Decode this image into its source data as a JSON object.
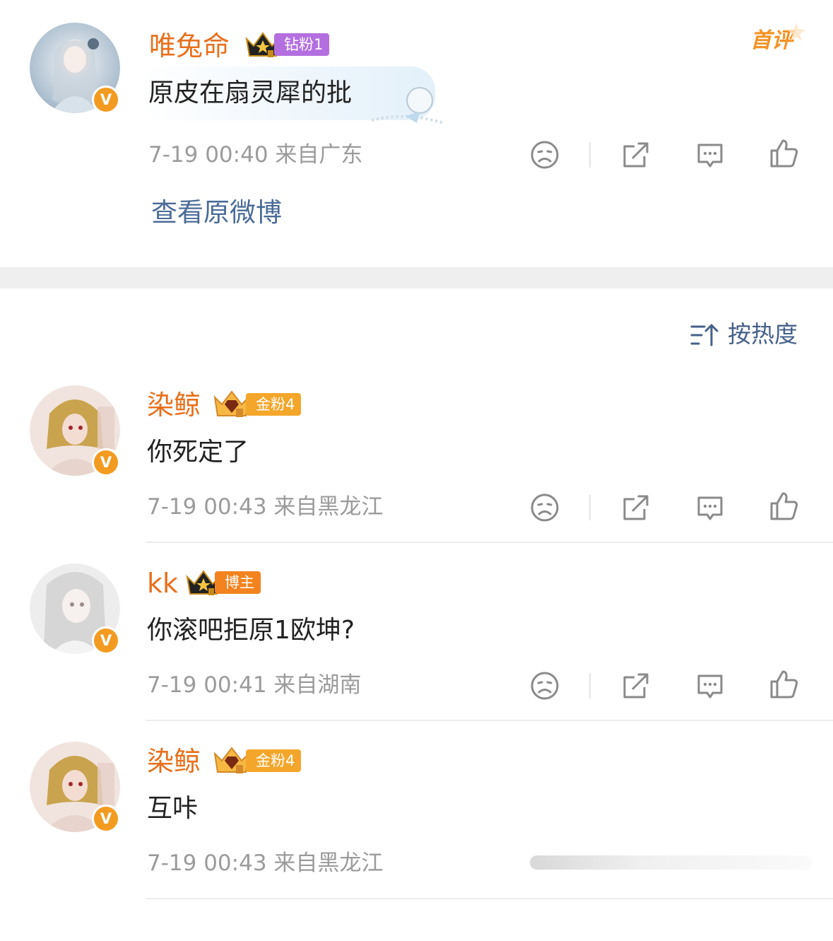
{
  "comments": [
    {
      "username": "唯兔命",
      "badge": "钻粉1",
      "text": "原皮在扇灵犀的批",
      "meta": "7-19 00:40  来自广东",
      "first_label": "首评",
      "link": "查看原微博"
    },
    {
      "username": "染鲸",
      "badge": "金粉4",
      "text": "你死定了",
      "meta": "7-19 00:43  来自黑龙江"
    },
    {
      "username": "kk",
      "badge": "博主",
      "text": "你滚吧拒原1欧坤?",
      "meta": "7-19 00:41  来自湖南"
    },
    {
      "username": "染鲸",
      "badge": "金粉4",
      "text": "互咔",
      "meta": "7-19 00:43  来自黑龙江"
    }
  ],
  "sort": {
    "label": "按热度",
    "icon": "sort-icon"
  },
  "icons": {
    "dislike": "sad-face-icon",
    "share": "share-icon",
    "reply": "comment-icon",
    "like": "thumbs-up-icon",
    "verified": "verified-v-icon",
    "crown": "crown-icon"
  },
  "colors": {
    "username": "#e8701c",
    "link": "#4a6b98",
    "badge_diamond": "#b36fe0",
    "badge_gold": "#f4a62a",
    "badge_blogger": "#f3831f",
    "verified": "#f39b21"
  }
}
